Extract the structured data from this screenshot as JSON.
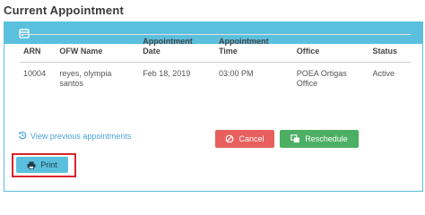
{
  "section_title": "Current Appointment",
  "header": {
    "icon": "calendar-icon"
  },
  "table": {
    "columns": [
      "ARN",
      "OFW Name",
      "Appointment Date",
      "Appointment Time",
      "Office",
      "Status"
    ],
    "column_lines": [
      [
        "ARN"
      ],
      [
        "OFW Name"
      ],
      [
        "Appointment",
        "Date"
      ],
      [
        "Appointment",
        "Time"
      ],
      [
        "Office"
      ],
      [
        "Status"
      ]
    ],
    "rows": [
      {
        "arn": "10004",
        "ofw_name_lines": [
          "reyes, olympia",
          "santos"
        ],
        "date": "Feb 18, 2019",
        "time": "03:00 PM",
        "office_lines": [
          "POEA Ortigas",
          "Office"
        ],
        "status": "Active"
      }
    ]
  },
  "links": {
    "view_previous": "View previous appointments"
  },
  "buttons": {
    "cancel": "Cancel",
    "reschedule": "Reschedule",
    "print": "Print"
  },
  "colors": {
    "header": "#5bc0de",
    "cancel": "#e8605d",
    "reschedule": "#4caf64",
    "print": "#5bc0de",
    "highlight": "#d9232a",
    "link": "#4aa3d8"
  }
}
